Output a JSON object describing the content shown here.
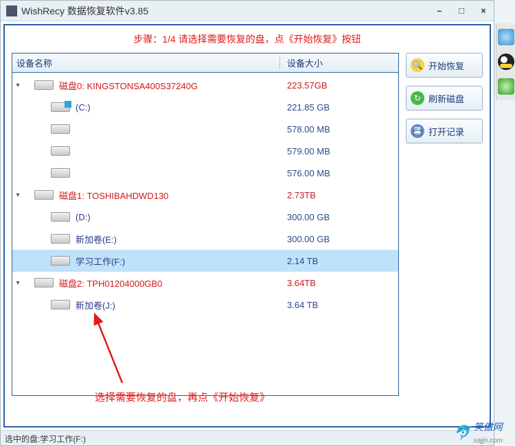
{
  "titlebar": {
    "title": "WishRecy 数据恢复软件v3.85"
  },
  "step_banner": "步骤：1/4 请选择需要恢复的盘，点《开始恢复》按钮",
  "headers": {
    "name": "设备名称",
    "size": "设备大小"
  },
  "tree": {
    "disks": [
      {
        "label": "磁盘0: KINGSTONSA400S37240G",
        "size": "223.57GB",
        "expanded": true,
        "partitions": [
          {
            "label": "(C:)",
            "size": "221.85 GB",
            "win": true
          },
          {
            "label": "",
            "size": "578.00 MB"
          },
          {
            "label": "",
            "size": "579.00 MB"
          },
          {
            "label": "",
            "size": "576.00 MB"
          }
        ]
      },
      {
        "label": "磁盘1: TOSHIBAHDWD130",
        "size": "2.73TB",
        "expanded": true,
        "partitions": [
          {
            "label": "(D:)",
            "size": "300.00 GB"
          },
          {
            "label": "新加卷(E:)",
            "size": "300.00 GB"
          },
          {
            "label": "学习工作(F:)",
            "size": "2.14 TB",
            "selected": true
          }
        ]
      },
      {
        "label": "磁盘2: TPH01204000GB0",
        "size": "3.64TB",
        "expanded": true,
        "partitions": [
          {
            "label": "新加卷(J:)",
            "size": "3.64 TB"
          }
        ]
      }
    ]
  },
  "sidebar": {
    "start": "开始恢复",
    "refresh": "刷新磁盘",
    "log": "打开记录"
  },
  "annotation": "选择需要恢复的盘，再点《开始恢复》",
  "status": {
    "selected_label": "选中的盘:学习工作(F:)"
  },
  "watermark": {
    "brand": "笑傲网",
    "domain": "xajjn.com"
  }
}
